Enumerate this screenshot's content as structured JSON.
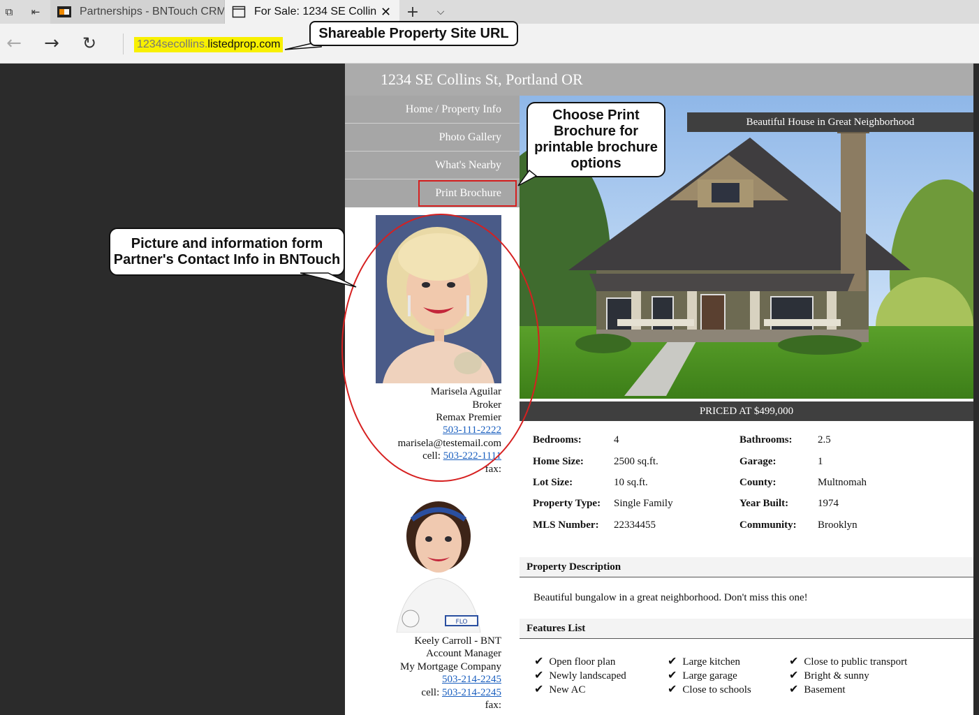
{
  "browser": {
    "tabs": [
      {
        "title": "Partnerships - BNTouch CRM"
      },
      {
        "title": "For Sale: 1234 SE Collins"
      }
    ],
    "url_subdomain": "1234secollins.",
    "url_domain": "listedprop.com"
  },
  "callouts": {
    "url": "Shareable Property Site URL",
    "print": "Choose Print Brochure for printable brochure options",
    "contact": "Picture and information form Partner's Contact Info in BNTouch"
  },
  "site": {
    "address": "1234 SE Collins St, Portland OR",
    "nav": [
      "Home / Property Info",
      "Photo Gallery",
      "What's Nearby",
      "Print Brochure"
    ],
    "hero_caption": "Beautiful House in Great Neighborhood",
    "price": "PRICED AT $499,000"
  },
  "specs": {
    "left": [
      {
        "label": "Bedrooms:",
        "value": "4"
      },
      {
        "label": "Home Size:",
        "value": "2500 sq.ft."
      },
      {
        "label": "Lot Size:",
        "value": "10 sq.ft."
      },
      {
        "label": "Property Type:",
        "value": "Single Family"
      },
      {
        "label": "MLS Number:",
        "value": "22334455"
      }
    ],
    "right": [
      {
        "label": "Bathrooms:",
        "value": "2.5"
      },
      {
        "label": "Garage:",
        "value": "1"
      },
      {
        "label": "County:",
        "value": "Multnomah"
      },
      {
        "label": "Year Built:",
        "value": "1974"
      },
      {
        "label": "Community:",
        "value": "Brooklyn"
      }
    ]
  },
  "description": {
    "heading": "Property Description",
    "text": "Beautiful bungalow in a great neighborhood. Don't miss this one!"
  },
  "features": {
    "heading": "Features List",
    "items": [
      "Open floor plan",
      "Newly landscaped",
      "New AC",
      "Large kitchen",
      "Large garage",
      "Close to schools",
      "Close to public transport",
      "Bright & sunny",
      "Basement"
    ]
  },
  "agents": [
    {
      "name": "Marisela Aguilar",
      "title": "Broker",
      "company": "Remax Premier",
      "phone": "503-111-2222",
      "email": "marisela@testemail.com",
      "cell_label": "cell:",
      "cell": "503-222-1111",
      "fax_label": "fax:"
    },
    {
      "name": "Keely Carroll - BNT",
      "title": "Account Manager",
      "company": "My Mortgage Company",
      "phone": "503-214-2245",
      "cell_label": "cell:",
      "cell": "503-214-2245",
      "fax_label": "fax:",
      "badge": "FLO"
    }
  ]
}
